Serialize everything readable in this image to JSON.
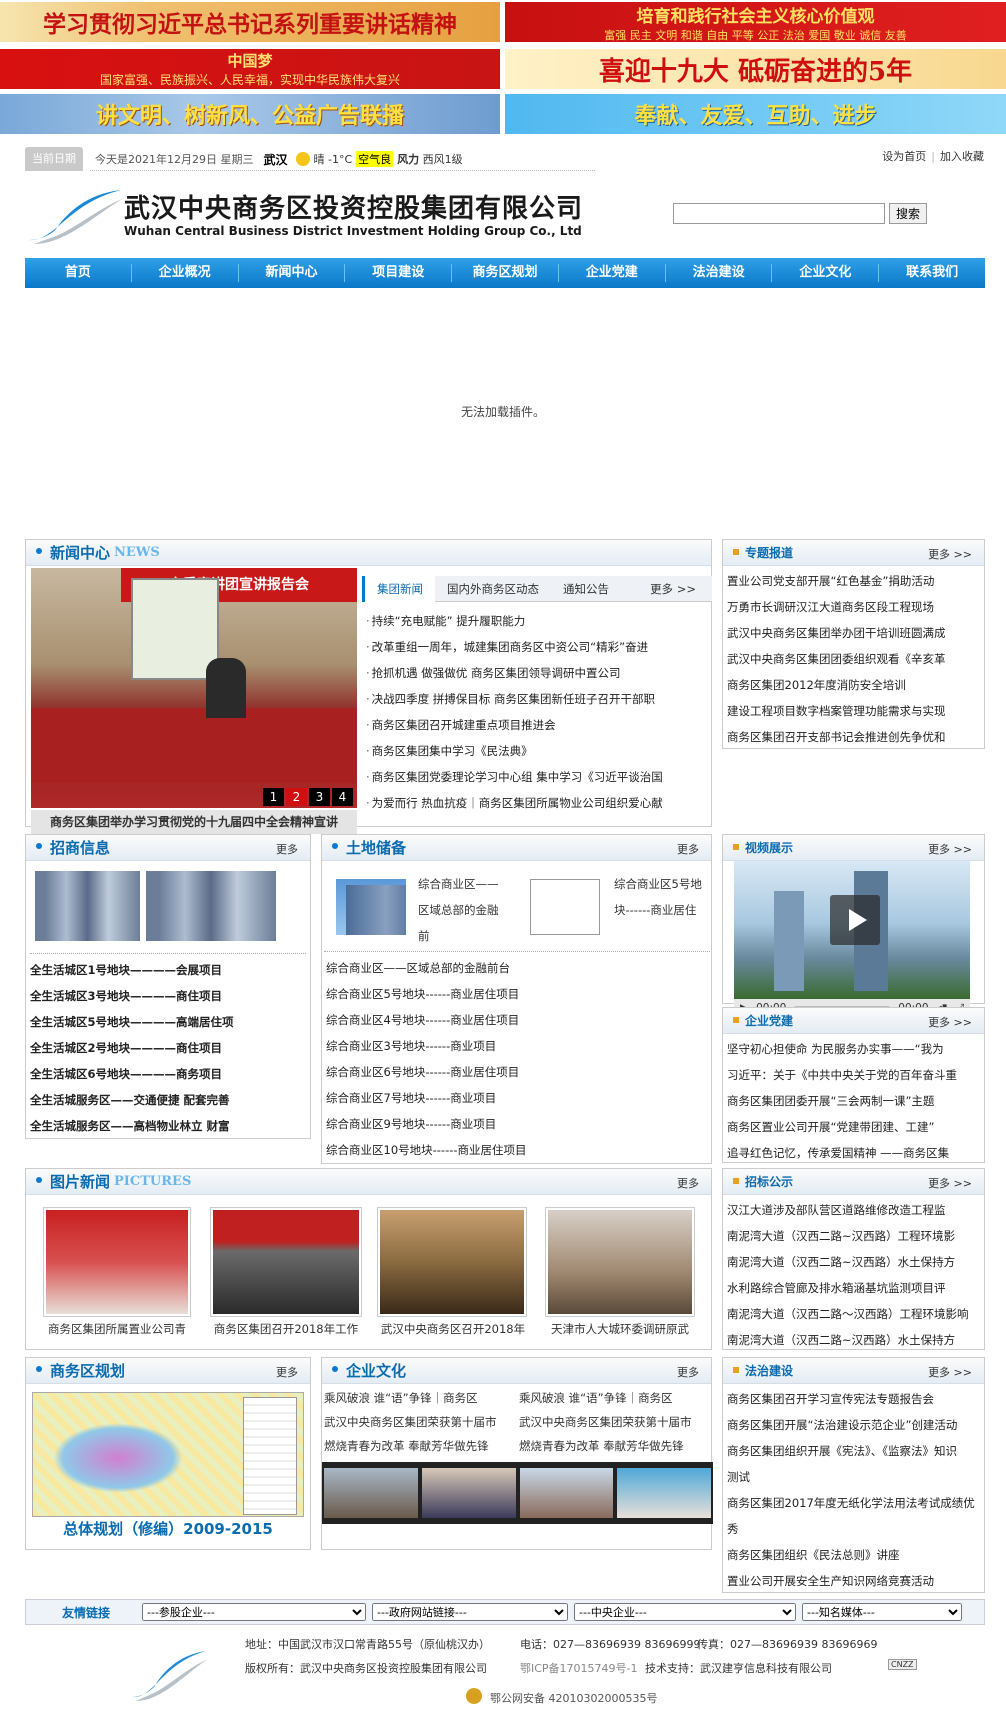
{
  "banners": {
    "b1": "学习贯彻习近平总书记系列重要讲话精神",
    "b2_title": "培育和践行社会主义核心价值观",
    "b2_sub": "富强 民主 文明 和谐  自由 平等 公正 法治  爱国 敬业 诚信 友善",
    "b3_title": "中国梦",
    "b3_sub": "国家富强、民族振兴、人民幸福，实现中华民族伟大复兴",
    "b4": "喜迎十九大 砥砺奋进的5年",
    "b5": "讲文明、树新风、公益广告联播",
    "b6": "奉献、友爱、互助、进步"
  },
  "datebar": {
    "label": "当前日期",
    "date": "今天是2021年12月29日 星期三",
    "city": "武汉",
    "weather": "晴 -1°C",
    "aq": "空气良",
    "wind_label": "风力",
    "wind": "西风1级"
  },
  "toplinks": {
    "home": "设为首页",
    "fav": "加入收藏"
  },
  "logo": {
    "cn": "武汉中央商务区投资控股集团有限公司",
    "en": "Wuhan Central Business District Investment Holding Group Co., Ltd"
  },
  "search": {
    "button": "搜索",
    "placeholder": ""
  },
  "nav": [
    "首页",
    "企业概况",
    "新闻中心",
    "项目建设",
    "商务区规划",
    "企业党建",
    "法治建设",
    "企业文化",
    "联系我们"
  ],
  "plugin": "无法加载插件。",
  "news": {
    "title": "新闻中心",
    "en": "NEWS",
    "slide_caption": "商务区集团举办学习贯彻党的十九届四中全会精神宣讲",
    "slide_banner": "市委宣讲团宣讲报告会",
    "pages": [
      "1",
      "2",
      "3",
      "4"
    ],
    "tabs": [
      "集团新闻",
      "国内外商务区动态",
      "通知公告"
    ],
    "more": "更多 >>",
    "items": [
      "持续“充电赋能” 提升履职能力",
      "改革重组一周年，城建集团商务区中资公司“精彩”奋进",
      "抢抓机遇 做强做优 商务区集团领导调研中置公司",
      "决战四季度 拼搏保目标 商务区集团新任班子召开干部职",
      "商务区集团召开城建重点项目推进会",
      "商务区集团集中学习《民法典》",
      "商务区集团党委理论学习中心组 集中学习《习近平谈治国",
      "为爱而行 热血抗疫｜商务区集团所属物业公司组织爱心献"
    ]
  },
  "special": {
    "title": "专题报道",
    "more": "更多 >>",
    "items": [
      "置业公司党支部开展“红色基金”捐助活动",
      "万勇市长调研汉江大道商务区段工程现场",
      "武汉中央商务区集团举办团干培训班圆满成",
      "武汉中央商务区集团团委组织观看《辛亥革",
      "商务区集团2012年度消防安全培训",
      "建设工程项目数字档案管理功能需求与实现",
      "商务区集团召开支部书记会推进创先争优和"
    ]
  },
  "invest": {
    "title": "招商信息",
    "more": "更多",
    "items": [
      "全生活城区1号地块————会展项目",
      "全生活城区3号地块————商住项目",
      "全生活城区5号地块————高端居住项",
      "全生活城区2号地块————商住项目",
      "全生活城区6号地块————商务项目",
      "全生活城服务区——交通便捷 配套完善",
      "全生活城服务区——高档物业林立 财富"
    ]
  },
  "land": {
    "title": "土地储备",
    "more": "更多",
    "feature1": "综合商业区——区域总部的金融前",
    "feature2": "综合商业区5号地块------商业居住",
    "items": [
      "综合商业区——区域总部的金融前台",
      "综合商业区5号地块------商业居住项目",
      "综合商业区4号地块------商业居住项目",
      "综合商业区3号地块------商业项目",
      "综合商业区6号地块------商业居住项目",
      "综合商业区7号地块------商业项目",
      "综合商业区9号地块------商业项目",
      "综合商业区10号地块------商业居住项目"
    ]
  },
  "video": {
    "title": "视频展示",
    "more": "更多 >>",
    "time1": "00:00",
    "time2": "00:00"
  },
  "party": {
    "title": "企业党建",
    "more": "更多 >>",
    "items": [
      "坚守初心担使命 为民服务办实事——“我为",
      "习近平：关于《中共中央关于党的百年奋斗重",
      "商务区集团团委开展“三会两制一课”主题",
      "商务区置业公司开展“党建带团建、工建”",
      "追寻红色记忆，传承爱国精神 ——商务区集"
    ]
  },
  "pictures": {
    "title": "图片新闻",
    "en": "PICTURES",
    "more": "更多",
    "captions": [
      "商务区集团所属置业公司青",
      "商务区集团召开2018年工作",
      "武汉中央商务区召开2018年",
      "天津市人大城环委调研原武"
    ]
  },
  "bidding": {
    "title": "招标公示",
    "more": "更多 >>",
    "items": [
      "汉江大道涉及部队营区道路维修改造工程监",
      "南泥湾大道（汉西二路~汉西路）工程环境影",
      "南泥湾大道（汉西二路~汉西路）水土保持方",
      "水利路综合管廊及排水箱涵基坑监测项目评",
      "南泥湾大道（汉西二路～汉西路）工程环境影响",
      "南泥湾大道（汉西二路~汉西路）水土保持方"
    ]
  },
  "planning": {
    "title": "商务区规划",
    "more": "更多",
    "caption": "总体规划（修编）2009-2015"
  },
  "culture": {
    "title": "企业文化",
    "more": "更多",
    "rows": [
      [
        "乘风破浪 谁“语”争锋｜商务区",
        "乘风破浪 谁“语”争锋｜商务区"
      ],
      [
        "武汉中央商务区集团荣获第十届市",
        "武汉中央商务区集团荣获第十届市"
      ],
      [
        "燃烧青春为改革 奉献芳华做先锋",
        "燃烧青春为改革 奉献芳华做先锋"
      ]
    ]
  },
  "law": {
    "title": "法治建设",
    "more": "更多 >>",
    "items": [
      "商务区集团召开学习宣传宪法专题报告会",
      "商务区集团开展“法治建设示范企业”创建活动",
      "商务区集团组织开展《宪法》、《监察法》知识",
      "测试",
      "商务区集团2017年度无纸化学法用法考试成绩优",
      "秀",
      "商务区集团组织《民法总则》讲座",
      "置业公司开展安全生产知识网络竞赛活动"
    ]
  },
  "friend": {
    "label": "友情链接",
    "selects": [
      "---参股企业---",
      "---政府网站链接---",
      "---中央企业---",
      "---知名媒体---"
    ]
  },
  "footer": {
    "addr": "地址：中国武汉市汉口常青路55号（原仙桃汉办）",
    "tel": "电话：027—83696939 83696999",
    "fax": "传真：027—83696939 83696969",
    "copy": "版权所有：武汉中央商务区投资控股集团有限公司",
    "icp": "鄂ICP备17015749号-1",
    "tech": "技术支持：武汉建亨信息科技有限公司",
    "badge": "CNZZ",
    "police": "鄂公网安备 42010302000535号"
  },
  "colors": {
    "nav": "#0a78c8",
    "accent": "#0a6cb0",
    "pager_active": "#d01010"
  }
}
